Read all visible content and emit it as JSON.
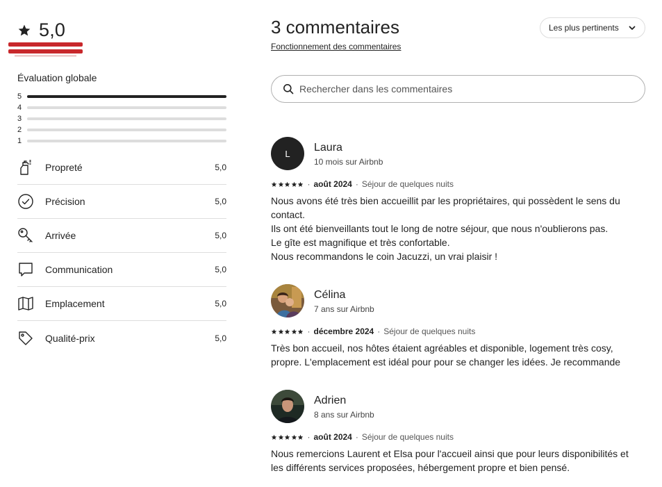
{
  "summary": {
    "score": "5,0",
    "overall_label": "Évaluation globale",
    "distribution": [
      {
        "label": "5",
        "fraction": 1.0
      },
      {
        "label": "4",
        "fraction": 0.0
      },
      {
        "label": "3",
        "fraction": 0.0
      },
      {
        "label": "2",
        "fraction": 0.0
      },
      {
        "label": "1",
        "fraction": 0.0
      }
    ],
    "categories": [
      {
        "icon": "spray-bottle-icon",
        "name": "Propreté",
        "value": "5,0"
      },
      {
        "icon": "check-circle-icon",
        "name": "Précision",
        "value": "5,0"
      },
      {
        "icon": "key-icon",
        "name": "Arrivée",
        "value": "5,0"
      },
      {
        "icon": "chat-bubble-icon",
        "name": "Communication",
        "value": "5,0"
      },
      {
        "icon": "map-icon",
        "name": "Emplacement",
        "value": "5,0"
      },
      {
        "icon": "price-tag-icon",
        "name": "Qualité-prix",
        "value": "5,0"
      }
    ]
  },
  "header": {
    "title": "3 commentaires",
    "how_link": "Fonctionnement des commentaires",
    "sort_label": "Les plus pertinents",
    "search_placeholder": "Rechercher dans les commentaires"
  },
  "reviews": [
    {
      "name": "Laura",
      "avatar_initial": "L",
      "since": "10 mois sur Airbnb",
      "rating": 5,
      "date": "août 2024",
      "stay": "Séjour de quelques nuits",
      "lines": [
        "Nous avons été très bien accueillit par les propriétaires, qui possèdent le sens du",
        "contact.",
        "Ils ont été bienveillants tout le long de notre séjour, que nous n'oublierons pas.",
        "Le gîte est magnifique et très confortable.",
        "Nous recommandons le coin Jacuzzi, un vrai plaisir !"
      ]
    },
    {
      "name": "Célina",
      "since": "7 ans sur Airbnb",
      "rating": 5,
      "date": "décembre 2024",
      "stay": "Séjour de quelques nuits",
      "lines": [
        "Très bon accueil, nos hôtes étaient agréables et disponible, logement très cosy,",
        "propre. L'emplacement est idéal pour pour se changer les idées. Je recommande"
      ]
    },
    {
      "name": "Adrien",
      "since": "8 ans sur Airbnb",
      "rating": 5,
      "date": "août 2024",
      "stay": "Séjour de quelques nuits",
      "lines": [
        "Nous remercions Laurent et Elsa pour l'accueil ainsi que pour leurs disponibilités et",
        "les différents services proposées, hébergement propre et bien pensé."
      ]
    }
  ],
  "colors": {
    "text": "#222222",
    "accent_red": "#c8282c",
    "divider": "#dddddd"
  }
}
